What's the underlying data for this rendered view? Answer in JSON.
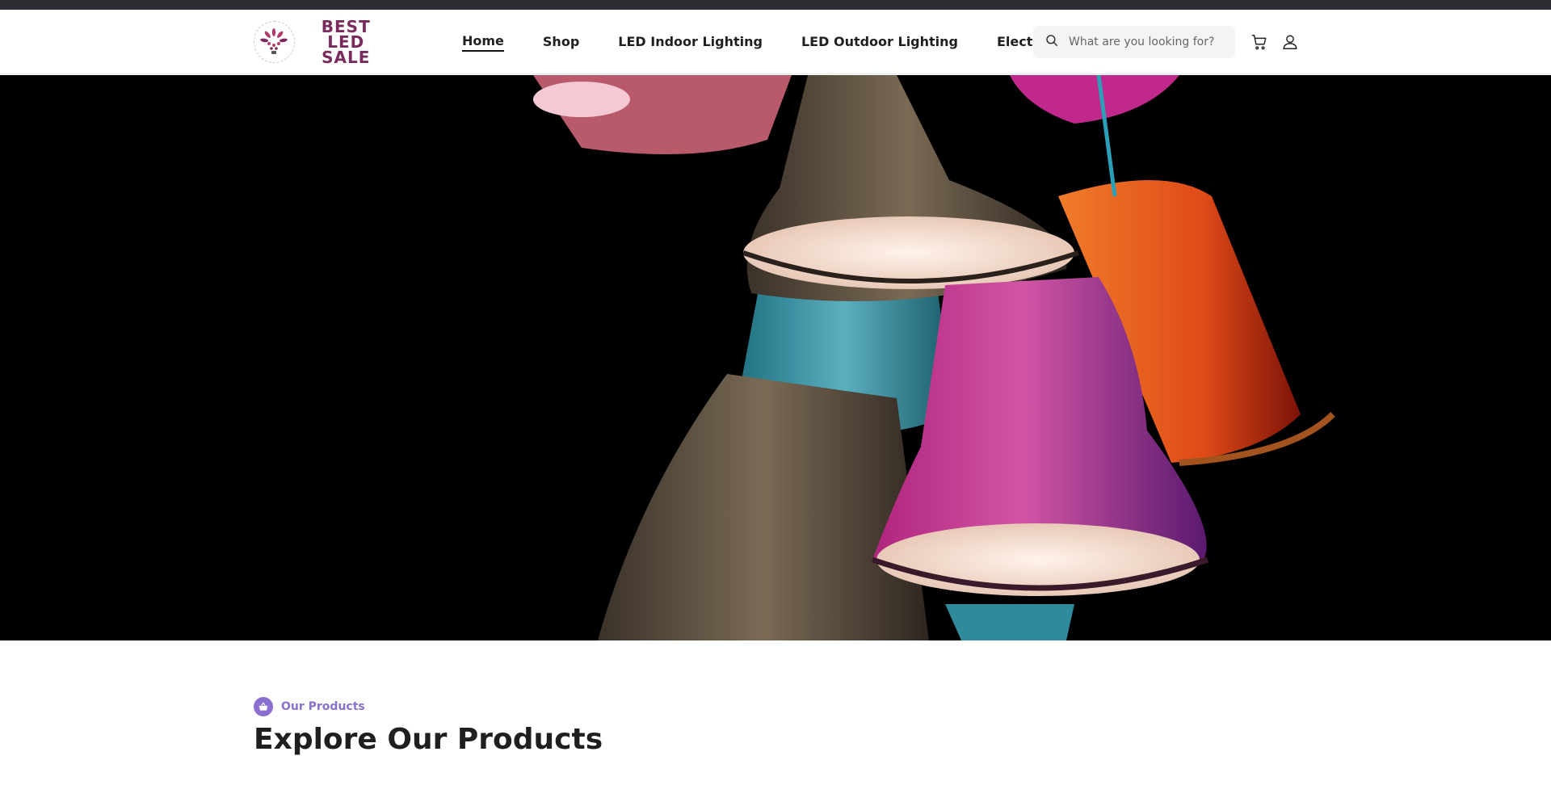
{
  "brand": {
    "line1": "BEST LED",
    "line2": "SALE"
  },
  "nav": {
    "items": [
      {
        "label": "Home",
        "active": true
      },
      {
        "label": "Shop",
        "active": false
      },
      {
        "label": "LED Indoor Lighting",
        "active": false
      },
      {
        "label": "LED Outdoor Lighting",
        "active": false
      },
      {
        "label": "Electrical",
        "active": false
      }
    ]
  },
  "search": {
    "placeholder": "What are you looking for?"
  },
  "icons": {
    "search": "search-icon",
    "cart": "cart-icon",
    "account": "user-icon",
    "section": "shopping-basket-icon"
  },
  "hero": {
    "image": "colorful hanging lamp shades on dark background"
  },
  "products_section": {
    "tag": "Our Products",
    "title": "Explore Our Products"
  },
  "colors": {
    "topbar": "#2b2d33",
    "accent": "#8a6fd1",
    "brand": "#7a2a5c"
  }
}
